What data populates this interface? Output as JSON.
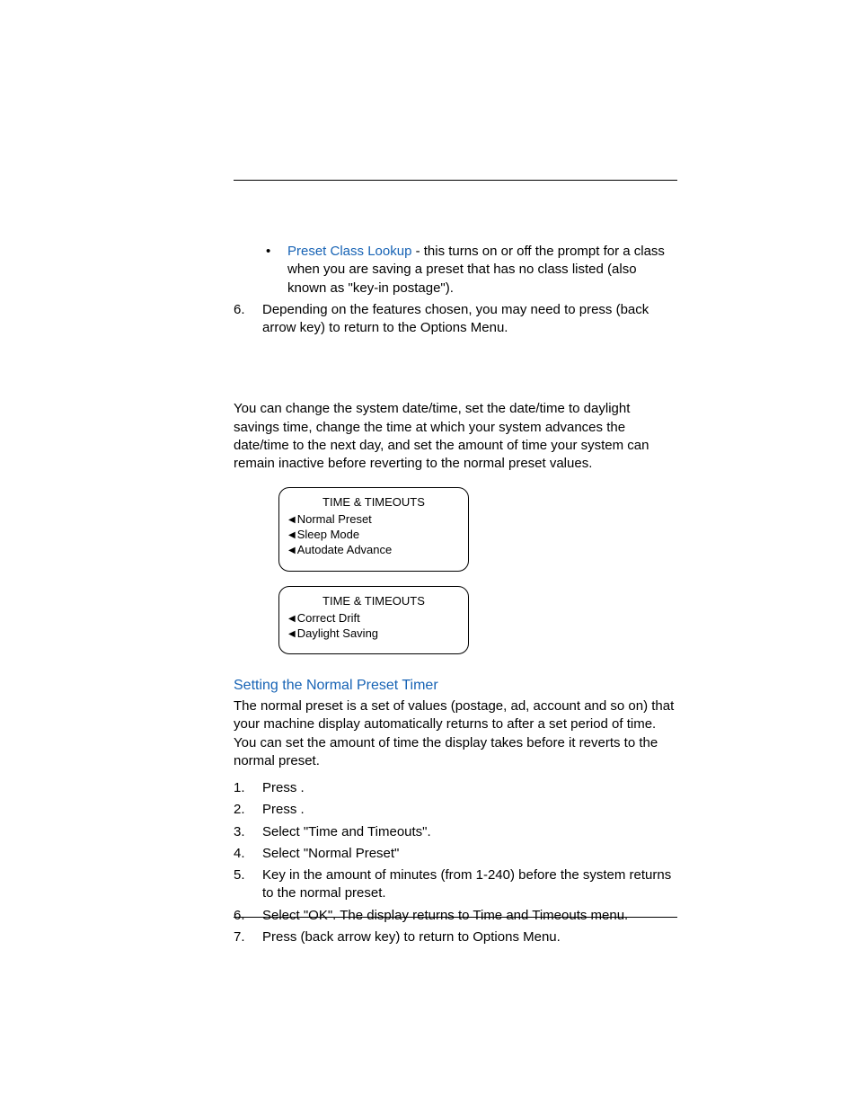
{
  "top_list": {
    "bullet": {
      "link_text": "Preset Class Lookup",
      "rest": " - this turns on or off the prompt for a class when you are saving a preset that has no class listed (also known as \"key-in postage\")."
    },
    "item6": {
      "num": "6.",
      "text": "Depending on the features chosen, you may need to press (back arrow key) to return to the Options Menu."
    }
  },
  "intro_paragraph": "You can change the system date/time, set the date/time to daylight savings time, change the time at which your system advances the date/time to the next day, and set the amount of time your system can remain inactive before reverting to the normal preset values.",
  "screen1": {
    "title": "TIME & TIMEOUTS",
    "items": [
      "Normal Preset",
      "Sleep Mode",
      "Autodate Advance"
    ]
  },
  "screen2": {
    "title": "TIME & TIMEOUTS",
    "items": [
      "Correct Drift",
      "Daylight Saving"
    ]
  },
  "subheading": "Setting the Normal Preset Timer",
  "sub_paragraph": "The normal preset is a set of values (postage, ad, account and so on) that your machine display automatically returns to after a set pe­riod of time. You can set the amount of time the display takes before it reverts to the normal preset.",
  "steps": [
    {
      "num": "1.",
      "text": "Press            ."
    },
    {
      "num": "2.",
      "text": "Press                   ."
    },
    {
      "num": "3.",
      "text": "Select \"Time and Timeouts\"."
    },
    {
      "num": "4.",
      "text": "Select \"Normal Preset\""
    },
    {
      "num": "5.",
      "text": "Key in the amount of minutes (from 1-240) before the system returns to the normal preset."
    },
    {
      "num": "6.",
      "text": "Select \"OK\". The display returns to Time and Timeouts menu."
    },
    {
      "num": "7.",
      "text": "Press          (back arrow key) to return to Options Menu."
    }
  ]
}
